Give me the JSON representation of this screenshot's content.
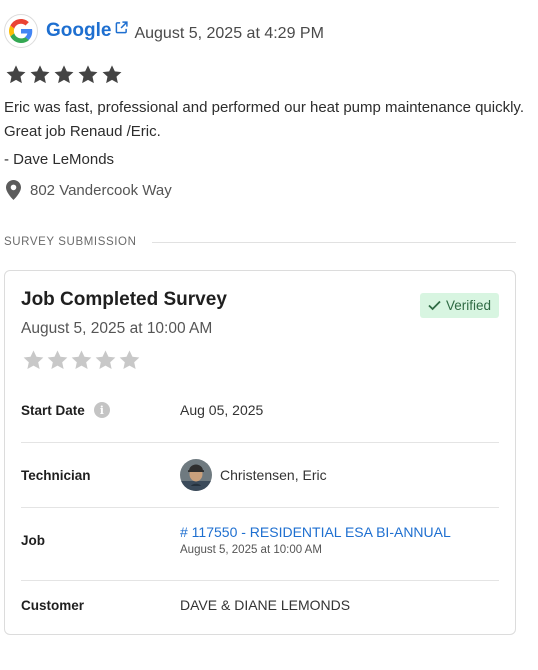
{
  "review": {
    "source": "Google",
    "date": "August 5, 2025 at 4:29 PM",
    "rating": 5,
    "text": "Eric was fast, professional and performed our heat pump maintenance quickly. Great job Renaud /Eric.",
    "author": "- Dave LeMonds",
    "location": "802 Vandercook Way"
  },
  "section_label": "SURVEY SUBMISSION",
  "survey": {
    "title": "Job Completed Survey",
    "date": "August 5, 2025 at 10:00 AM",
    "badge": "Verified",
    "rating": 0,
    "rows": {
      "start_date": {
        "label": "Start Date",
        "value": "Aug 05, 2025"
      },
      "technician": {
        "label": "Technician",
        "value": "Christensen, Eric"
      },
      "job": {
        "label": "Job",
        "value": "# 117550 - RESIDENTIAL ESA BI-ANNUAL",
        "sub": "August 5, 2025 at 10:00 AM"
      },
      "customer": {
        "label": "Customer",
        "value": "DAVE & DIANE LEMONDS"
      }
    }
  },
  "colors": {
    "link": "#1e6fd0",
    "star_filled": "#444444",
    "star_empty": "#c8c8c8",
    "verified_bg": "#d8f5e1",
    "verified_text": "#2f6b44"
  },
  "icons": [
    "google-logo-icon",
    "external-link-icon",
    "star-icon",
    "location-pin-icon",
    "checkmark-icon",
    "info-icon"
  ]
}
